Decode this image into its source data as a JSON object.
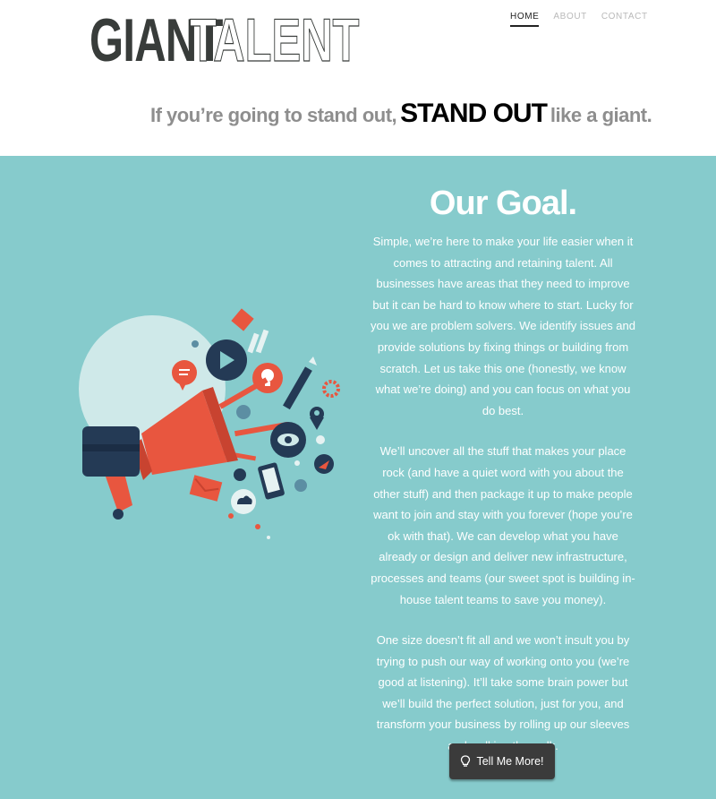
{
  "brand": {
    "logo_bold": "GIANT",
    "logo_outline": "TALENT"
  },
  "nav": {
    "items": [
      {
        "label": "HOME",
        "active": true
      },
      {
        "label": "ABOUT",
        "active": false
      },
      {
        "label": "CONTACT",
        "active": false
      }
    ]
  },
  "tagline": {
    "before": "If you’re going to stand out,",
    "emphasis": "STAND OUT",
    "after": "like a giant."
  },
  "goal": {
    "title": "Our Goal.",
    "paragraphs": [
      "Simple, we’re here to make your life easier when it comes to attracting and retaining talent. All businesses have areas that they need to improve but it can be hard to know where to start.  Lucky for you we are problem solvers.  We identify issues and provide solutions by fixing things or building from scratch. Let us take this one (honestly, we know what we’re doing) and you can focus on what you do best.",
      "We’ll uncover all the stuff that makes your place rock (and have a quiet word with you about the other stuff) and then package it up to make people want to join and stay with you forever (hope you’re ok with that). We can develop what you have already or design and deliver new infrastructure, processes and teams (our sweet spot is building in-house talent teams to save you money).",
      "One size doesn’t fit all and we won’t insult you by trying to push our way of working onto you (we’re good at listening). It’ll take some brain power but we’ll build the perfect solution, just for you, and transform your business by rolling up our sleeves and walking the walk."
    ]
  },
  "cta": {
    "label": "Tell Me More!",
    "icon": "lightbulb-icon"
  },
  "colors": {
    "section_bg": "#86cbcc",
    "header_bg": "#ffffff",
    "logo_dark": "#383c3a",
    "accent_red": "#e8563f",
    "navy": "#243a55",
    "button_bg": "#3b3b3b"
  }
}
